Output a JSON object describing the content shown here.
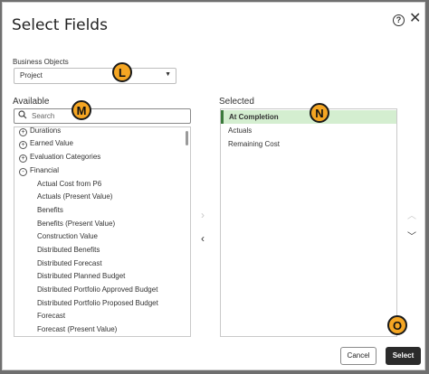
{
  "dialog": {
    "title": "Select Fields",
    "help_icon": "help-icon",
    "close_icon": "close-icon"
  },
  "business_objects": {
    "label": "Business Objects",
    "selected": "Project"
  },
  "available": {
    "label": "Available",
    "search_placeholder": "Search",
    "items": [
      {
        "label": "Durations",
        "expander": "+"
      },
      {
        "label": "Earned Value",
        "expander": "+"
      },
      {
        "label": "Evaluation Categories",
        "expander": "+"
      },
      {
        "label": "Financial",
        "expander": "-"
      },
      {
        "label": "Actual Cost from P6"
      },
      {
        "label": "Actuals (Present Value)"
      },
      {
        "label": "Benefits"
      },
      {
        "label": "Benefits (Present Value)"
      },
      {
        "label": "Construction Value"
      },
      {
        "label": "Distributed Benefits"
      },
      {
        "label": "Distributed Forecast"
      },
      {
        "label": "Distributed Planned Budget"
      },
      {
        "label": "Distributed Portfolio Approved Budget"
      },
      {
        "label": "Distributed Portfolio Proposed Budget"
      },
      {
        "label": "Forecast"
      },
      {
        "label": "Forecast (Present Value)"
      }
    ]
  },
  "selected": {
    "label": "Selected",
    "items": [
      "At Completion",
      "Actuals",
      "Remaining Cost"
    ],
    "active_index": 0
  },
  "buttons": {
    "cancel": "Cancel",
    "select": "Select"
  },
  "callouts": [
    "L",
    "M",
    "N",
    "O"
  ],
  "colors": {
    "callout_fill": "#f5a623",
    "selected_highlight": "#d4eed0",
    "primary_button": "#2b2b2b"
  }
}
